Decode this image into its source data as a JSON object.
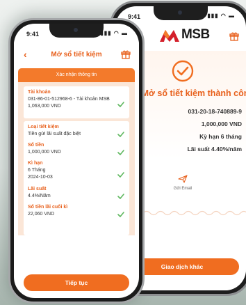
{
  "status_bar": {
    "time": "9:41"
  },
  "back_screen": {
    "brand": "MSB",
    "success_title": "Mở sổ tiết kiệm thành công",
    "account_number": "031-20-18-740889-9",
    "amount": "1,000,000 VND",
    "term": "Kỳ hạn 6 tháng",
    "interest_rate": "Lãi suất 4.40%/năm",
    "send_email_label": "Gửi Email",
    "other_transaction_label": "Giao dịch khác"
  },
  "front_screen": {
    "title": "Mở sổ tiết kiệm",
    "confirm_label": "Xác nhận thông tin",
    "fields": [
      {
        "label": "Tài khoản",
        "values": [
          "031-86-01-512968-6 - Tài khoản MSB",
          "1,063,000 VND"
        ]
      },
      {
        "label": "Loại tiết kiệm",
        "values": [
          "Tiền gửi lãi suất đặc biệt"
        ]
      },
      {
        "label": "Số tiền",
        "values": [
          "1,000,000 VND"
        ]
      },
      {
        "label": "Kì hạn",
        "values": [
          "6 Tháng",
          "2024-10-03"
        ]
      },
      {
        "label": "Lãi suất",
        "values": [
          "4.4%/Năm"
        ]
      },
      {
        "label": "Số tiền lãi cuối kì",
        "values": [
          "22,060 VND"
        ]
      }
    ],
    "continue_label": "Tiếp tục"
  },
  "colors": {
    "accent": "#f06d20",
    "accent_dark": "#e8601c",
    "success_check": "#5fb85f",
    "brand_red": "#d4202b"
  }
}
